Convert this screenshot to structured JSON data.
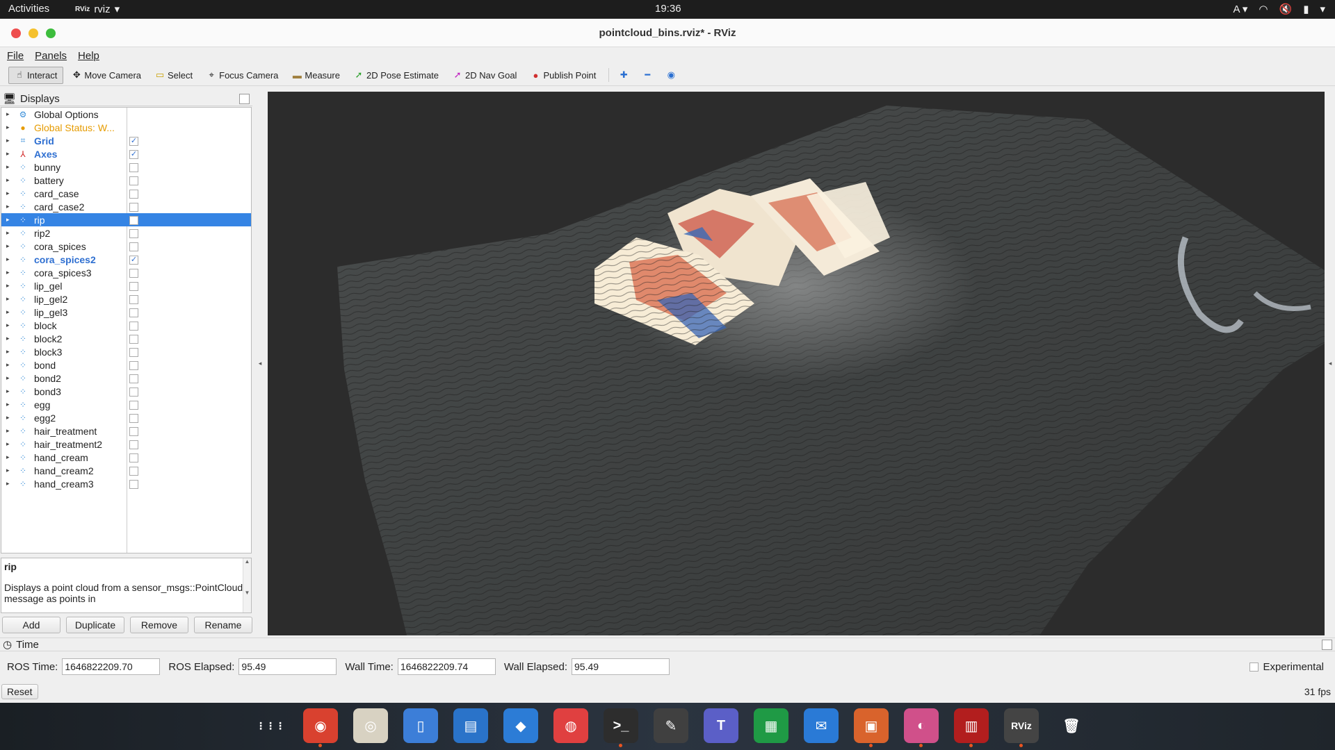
{
  "topbar": {
    "activities": "Activities",
    "app_name": "rviz",
    "app_badge": "RViz",
    "clock": "19:36",
    "input_method": "A"
  },
  "window": {
    "title": "pointcloud_bins.rviz* - RViz",
    "close_color": "#ee4e4e",
    "minimize_color": "#f5c12e",
    "maximize_color": "#3dbd3d"
  },
  "menu": {
    "file": "File",
    "panels": "Panels",
    "help": "Help"
  },
  "toolbar": {
    "interact": "Interact",
    "move_camera": "Move Camera",
    "select": "Select",
    "focus_camera": "Focus Camera",
    "measure": "Measure",
    "pose_estimate": "2D Pose Estimate",
    "nav_goal": "2D Nav Goal",
    "publish_point": "Publish Point"
  },
  "displays": {
    "title": "Displays",
    "items": [
      {
        "label": "Global Options",
        "icon": "gear-icon",
        "checked": null,
        "style": ""
      },
      {
        "label": "Global Status: W...",
        "icon": "warning-icon",
        "checked": null,
        "style": "warn"
      },
      {
        "label": "Grid",
        "icon": "grid-icon",
        "checked": true,
        "style": "blue"
      },
      {
        "label": "Axes",
        "icon": "axes-icon",
        "checked": true,
        "style": "blue"
      },
      {
        "label": "bunny",
        "icon": "pointcloud-icon",
        "checked": false,
        "style": ""
      },
      {
        "label": "battery",
        "icon": "pointcloud-icon",
        "checked": false,
        "style": ""
      },
      {
        "label": "card_case",
        "icon": "pointcloud-icon",
        "checked": false,
        "style": ""
      },
      {
        "label": "card_case2",
        "icon": "pointcloud-icon",
        "checked": false,
        "style": ""
      },
      {
        "label": "rip",
        "icon": "pointcloud-icon",
        "checked": false,
        "style": "selected"
      },
      {
        "label": "rip2",
        "icon": "pointcloud-icon",
        "checked": false,
        "style": ""
      },
      {
        "label": "cora_spices",
        "icon": "pointcloud-icon",
        "checked": false,
        "style": ""
      },
      {
        "label": "cora_spices2",
        "icon": "pointcloud-icon",
        "checked": true,
        "style": "blue"
      },
      {
        "label": "cora_spices3",
        "icon": "pointcloud-icon",
        "checked": false,
        "style": ""
      },
      {
        "label": "lip_gel",
        "icon": "pointcloud-icon",
        "checked": false,
        "style": ""
      },
      {
        "label": "lip_gel2",
        "icon": "pointcloud-icon",
        "checked": false,
        "style": ""
      },
      {
        "label": "lip_gel3",
        "icon": "pointcloud-icon",
        "checked": false,
        "style": ""
      },
      {
        "label": "block",
        "icon": "pointcloud-icon",
        "checked": false,
        "style": ""
      },
      {
        "label": "block2",
        "icon": "pointcloud-icon",
        "checked": false,
        "style": ""
      },
      {
        "label": "block3",
        "icon": "pointcloud-icon",
        "checked": false,
        "style": ""
      },
      {
        "label": "bond",
        "icon": "pointcloud-icon",
        "checked": false,
        "style": ""
      },
      {
        "label": "bond2",
        "icon": "pointcloud-icon",
        "checked": false,
        "style": ""
      },
      {
        "label": "bond3",
        "icon": "pointcloud-icon",
        "checked": false,
        "style": ""
      },
      {
        "label": "egg",
        "icon": "pointcloud-icon",
        "checked": false,
        "style": ""
      },
      {
        "label": "egg2",
        "icon": "pointcloud-icon",
        "checked": false,
        "style": ""
      },
      {
        "label": "hair_treatment",
        "icon": "pointcloud-icon",
        "checked": false,
        "style": ""
      },
      {
        "label": "hair_treatment2",
        "icon": "pointcloud-icon",
        "checked": false,
        "style": ""
      },
      {
        "label": "hand_cream",
        "icon": "pointcloud-icon",
        "checked": false,
        "style": ""
      },
      {
        "label": "hand_cream2",
        "icon": "pointcloud-icon",
        "checked": false,
        "style": ""
      },
      {
        "label": "hand_cream3",
        "icon": "pointcloud-icon",
        "checked": false,
        "style": ""
      }
    ],
    "description_title": "rip",
    "description_text": "Displays a point cloud from a sensor_msgs::PointCloud2 message as points in",
    "buttons": {
      "add": "Add",
      "duplicate": "Duplicate",
      "remove": "Remove",
      "rename": "Rename"
    }
  },
  "time": {
    "title": "Time",
    "ros_time_label": "ROS Time:",
    "ros_time": "1646822209.70",
    "ros_elapsed_label": "ROS Elapsed:",
    "ros_elapsed": "95.49",
    "wall_time_label": "Wall Time:",
    "wall_time": "1646822209.74",
    "wall_elapsed_label": "Wall Elapsed:",
    "wall_elapsed": "95.49",
    "experimental": "Experimental",
    "reset": "Reset",
    "fps": "31 fps"
  },
  "dock": {
    "apps": [
      {
        "name": "show-applications-icon",
        "glyph": "⋮⋮⋮",
        "color": "transparent",
        "running": false
      },
      {
        "name": "chrome-icon",
        "glyph": "◉",
        "color": "#d9412f",
        "running": true
      },
      {
        "name": "rhythmbox-icon",
        "glyph": "◎",
        "color": "#d8d2c2",
        "running": false
      },
      {
        "name": "files-icon",
        "glyph": "▯",
        "color": "#3c7ed8",
        "running": false
      },
      {
        "name": "writer-icon",
        "glyph": "▤",
        "color": "#2a73c9",
        "running": false
      },
      {
        "name": "software-icon",
        "glyph": "◆",
        "color": "#2c7cd6",
        "running": false
      },
      {
        "name": "help-icon",
        "glyph": "◍",
        "color": "#e04040",
        "running": false
      },
      {
        "name": "terminal-icon",
        "glyph": ">_",
        "color": "#2d2d2d",
        "running": true
      },
      {
        "name": "inkscape-icon",
        "glyph": "✎",
        "color": "#404040",
        "running": false
      },
      {
        "name": "teams-icon",
        "glyph": "T",
        "color": "#5b5fc7",
        "running": false
      },
      {
        "name": "calc-icon",
        "glyph": "▦",
        "color": "#1f9a45",
        "running": false
      },
      {
        "name": "thunderbird-icon",
        "glyph": "✉",
        "color": "#2a7ad6",
        "running": false
      },
      {
        "name": "impress-icon",
        "glyph": "▣",
        "color": "#d9632c",
        "running": true
      },
      {
        "name": "mixer-icon",
        "glyph": "◐",
        "color": "#d0508a",
        "running": true
      },
      {
        "name": "media-icon",
        "glyph": "▥",
        "color": "#b21e1e",
        "running": true
      },
      {
        "name": "rviz-icon",
        "glyph": "RViz",
        "color": "#444",
        "running": true
      },
      {
        "name": "trash-icon",
        "glyph": "🗑",
        "color": "transparent",
        "running": false
      }
    ]
  }
}
